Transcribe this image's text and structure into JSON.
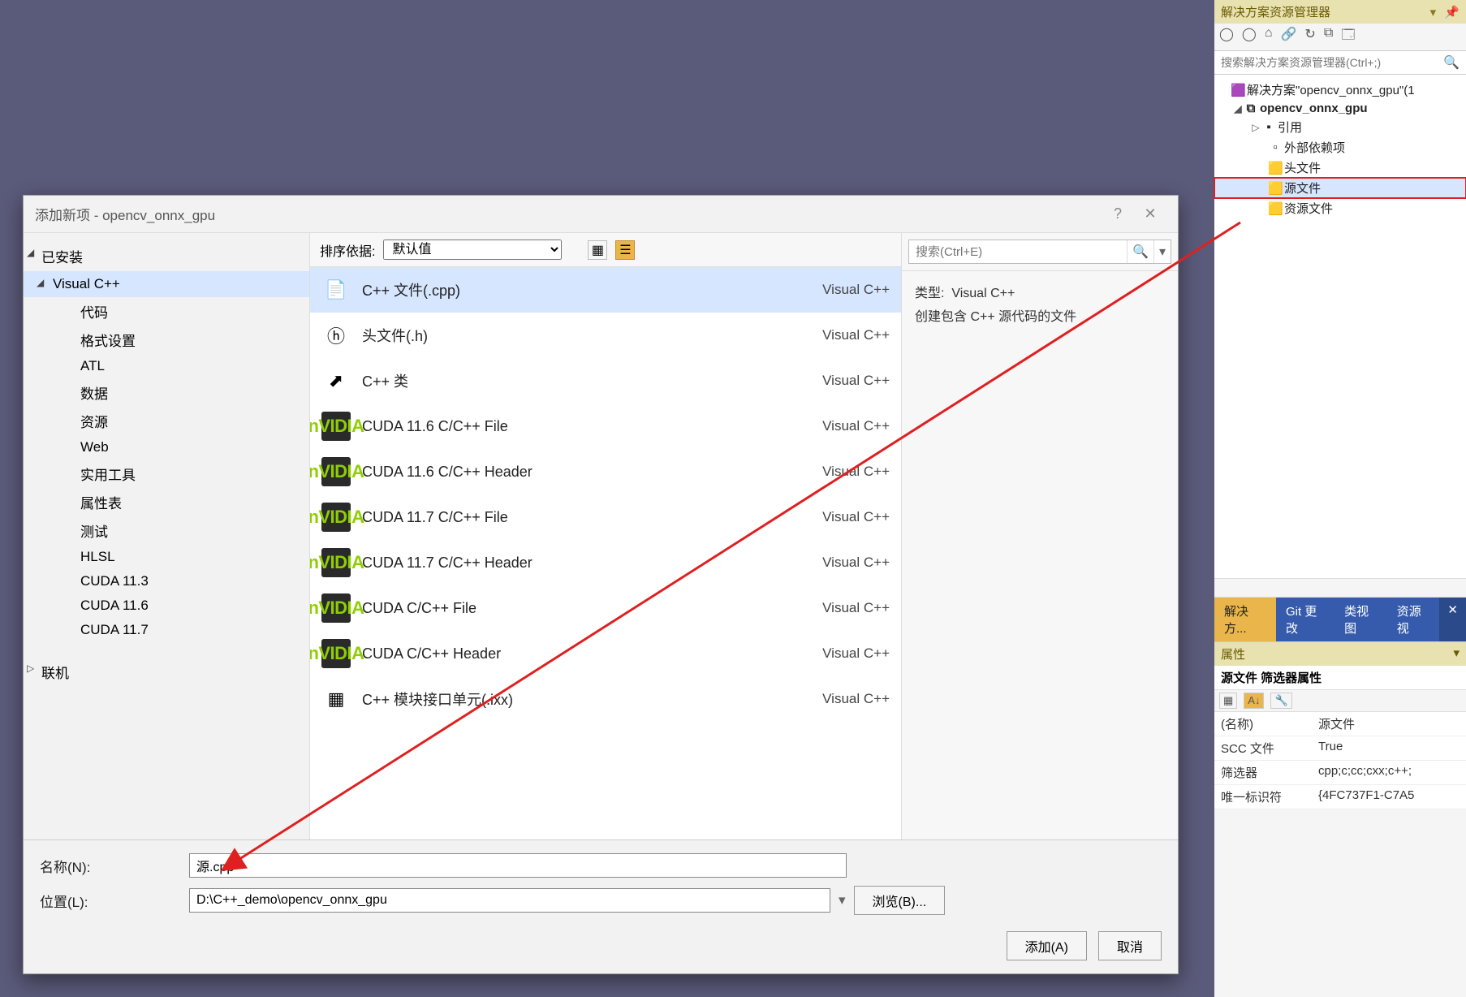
{
  "solution_panel": {
    "title": "解决方案资源管理器",
    "search_placeholder": "搜索解决方案资源管理器(Ctrl+;)",
    "root": "解决方案\"opencv_onnx_gpu\"(1",
    "project": "opencv_onnx_gpu",
    "nodes": {
      "refs": "引用",
      "ext": "外部依赖项",
      "headers": "头文件",
      "sources": "源文件",
      "resources": "资源文件"
    }
  },
  "bottom_tabs": {
    "t1": "解决方...",
    "t2": "Git 更改",
    "t3": "类视图",
    "t4": "资源视"
  },
  "properties": {
    "title": "属性",
    "subtitle": "源文件 筛选器属性",
    "rows": [
      {
        "k": "(名称)",
        "v": "源文件"
      },
      {
        "k": "SCC 文件",
        "v": "True"
      },
      {
        "k": "筛选器",
        "v": "cpp;c;cc;cxx;c++;"
      },
      {
        "k": "唯一标识符",
        "v": "{4FC737F1-C7A5"
      }
    ]
  },
  "dialog": {
    "title": "添加新项 - opencv_onnx_gpu",
    "left": {
      "installed": "已安装",
      "vcpp": "Visual C++",
      "subs": [
        "代码",
        "格式设置",
        "ATL",
        "数据",
        "资源",
        "Web",
        "实用工具",
        "属性表",
        "测试",
        "HLSL",
        "CUDA 11.3",
        "CUDA 11.6",
        "CUDA 11.7"
      ],
      "online": "联机"
    },
    "sort_label": "排序依据:",
    "sort_value": "默认值",
    "templates": [
      {
        "name": "C++ 文件(.cpp)",
        "plat": "Visual C++",
        "icon": "cpp",
        "sel": true
      },
      {
        "name": "头文件(.h)",
        "plat": "Visual C++",
        "icon": "h"
      },
      {
        "name": "C++ 类",
        "plat": "Visual C++",
        "icon": "class"
      },
      {
        "name": "CUDA 11.6 C/C++ File",
        "plat": "Visual C++",
        "icon": "nvidia"
      },
      {
        "name": "CUDA 11.6 C/C++ Header",
        "plat": "Visual C++",
        "icon": "nvidia"
      },
      {
        "name": "CUDA 11.7 C/C++ File",
        "plat": "Visual C++",
        "icon": "nvidia"
      },
      {
        "name": "CUDA 11.7 C/C++ Header",
        "plat": "Visual C++",
        "icon": "nvidia"
      },
      {
        "name": "CUDA C/C++ File",
        "plat": "Visual C++",
        "icon": "nvidia"
      },
      {
        "name": "CUDA C/C++ Header",
        "plat": "Visual C++",
        "icon": "nvidia"
      },
      {
        "name": "C++ 模块接口单元(.ixx)",
        "plat": "Visual C++",
        "icon": "mod"
      }
    ],
    "search_placeholder": "搜索(Ctrl+E)",
    "desc_type_label": "类型:",
    "desc_type_value": "Visual C++",
    "desc_body": "创建包含 C++ 源代码的文件",
    "name_label": "名称(N):",
    "name_value": "源.cpp",
    "loc_label": "位置(L):",
    "loc_value": "D:\\C++_demo\\opencv_onnx_gpu",
    "browse": "浏览(B)...",
    "add": "添加(A)",
    "cancel": "取消"
  }
}
